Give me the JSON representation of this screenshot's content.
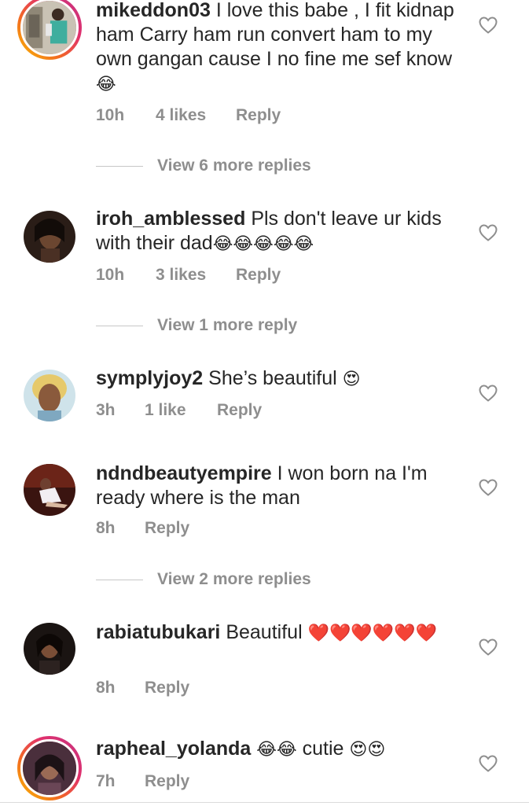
{
  "comments": [
    {
      "username": "mikeddon03",
      "text": "I love this babe , I fit kidnap ham Carry ham run convert ham to my own gangan cause I no fine me sef know",
      "emoji": "😂",
      "time": "10h",
      "likes": "4 likes",
      "reply": "Reply",
      "view_more": "View 6 more replies"
    },
    {
      "username": "iroh_amblessed",
      "text": "Pls don't leave ur kids with their dad",
      "emoji": "😂😂😂😂😂",
      "time": "10h",
      "likes": "3 likes",
      "reply": "Reply",
      "view_more": "View 1 more reply"
    },
    {
      "username": "symplyjoy2",
      "text": "She’s beautiful",
      "emoji": "😍",
      "time": "3h",
      "likes": "1 like",
      "reply": "Reply"
    },
    {
      "username": "ndndbeautyempire",
      "text": "I won born na I'm ready where is the man",
      "time": "8h",
      "reply": "Reply",
      "view_more": "View 2 more replies"
    },
    {
      "username": "rabiatubukari",
      "text": "Beautiful",
      "emoji": "❤️❤️❤️❤️❤️❤️",
      "time": "8h",
      "reply": "Reply"
    },
    {
      "username": "rapheal_yolanda",
      "emoji": "😂😂",
      "text": "cutie",
      "emoji2": "😍😍",
      "time": "7h",
      "reply": "Reply"
    }
  ],
  "icons": {
    "like": "heart-outline-icon",
    "avatar": "profile-photo"
  },
  "colors": {
    "text": "#262626",
    "meta": "#8e8e8e",
    "story_ring": [
      "#f9c000",
      "#e1306c",
      "#c13584"
    ]
  }
}
